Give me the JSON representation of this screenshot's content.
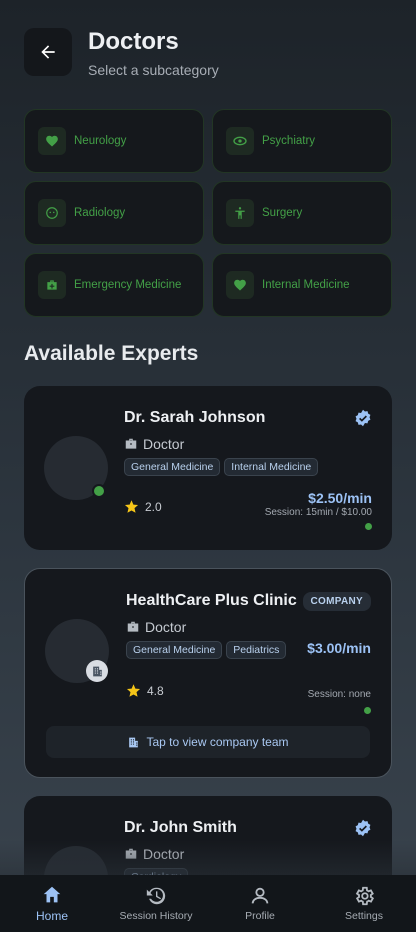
{
  "header": {
    "title": "Doctors",
    "subtitle": "Select a subcategory",
    "back_icon": "arrow-left-icon"
  },
  "categories": [
    {
      "label": "Neurology",
      "icon": "heart-icon"
    },
    {
      "label": "Psychiatry",
      "icon": "eye-icon"
    },
    {
      "label": "Radiology",
      "icon": "face-icon"
    },
    {
      "label": "Surgery",
      "icon": "accessibility-icon"
    },
    {
      "label": "Emergency Medicine",
      "icon": "medical-kit-icon"
    },
    {
      "label": "Internal Medicine",
      "icon": "heart-icon"
    }
  ],
  "section_title": "Available Experts",
  "experts": [
    {
      "name": "Dr. Sarah Johnson",
      "role": "Doctor",
      "tags": [
        "General Medicine",
        "Internal Medicine"
      ],
      "rating": "2.0",
      "price": "$2.50/min",
      "session": "Session: 15min / $10.00",
      "verified": true
    },
    {
      "name": "HealthCare Plus Clinic",
      "badge": "COMPANY",
      "role": "Doctor",
      "tags": [
        "General Medicine",
        "Pediatrics"
      ],
      "rating": "4.8",
      "price": "$3.00/min",
      "session": "Session: none",
      "team_button": "Tap to view company team"
    },
    {
      "name": "Dr. John Smith",
      "role": "Doctor",
      "tags": [
        "Cardiology"
      ],
      "verified": true
    }
  ],
  "bottom_nav": [
    {
      "label": "Home",
      "icon": "home-icon",
      "active": true
    },
    {
      "label": "Session History",
      "icon": "history-icon",
      "active": false
    },
    {
      "label": "Profile",
      "icon": "person-icon",
      "active": false
    },
    {
      "label": "Settings",
      "icon": "gear-icon",
      "active": false
    }
  ],
  "colors": {
    "accent_green": "#43a047",
    "accent_blue": "#9cc2f5",
    "card_bg": "#15181d"
  }
}
